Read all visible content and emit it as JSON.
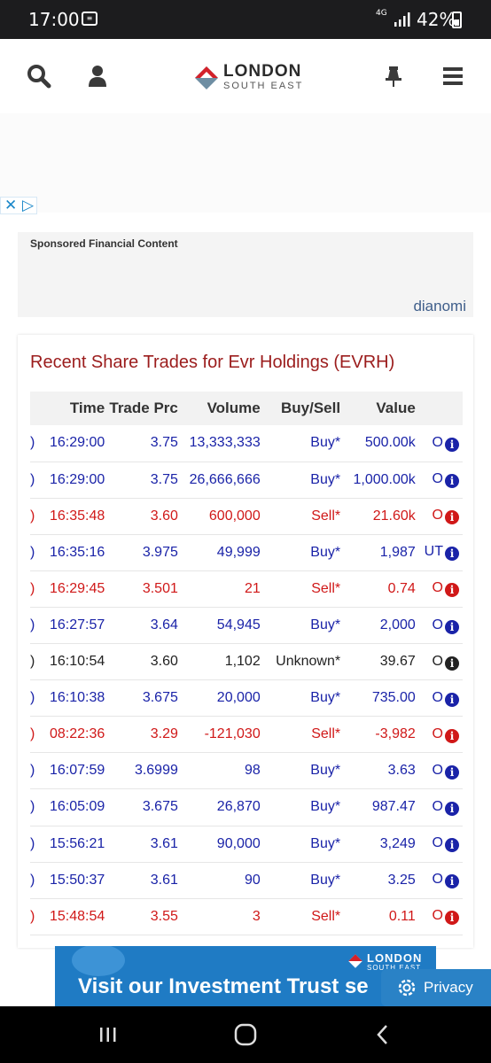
{
  "status_bar": {
    "time": "17:00",
    "network": "4G",
    "battery": "42%"
  },
  "header": {
    "logo_name": "LONDON",
    "logo_sub": "SOUTH EAST",
    "icons": [
      "search-icon",
      "user-icon",
      "pin-icon",
      "menu-icon"
    ]
  },
  "ad_controls": {
    "close": "✕",
    "adchoices": "▷"
  },
  "sponsored": {
    "label": "Sponsored Financial Content",
    "brand": "dianomi"
  },
  "trades": {
    "title": "Recent Share Trades for Evr Holdings (EVRH)",
    "headers": {
      "time": "Time",
      "price": "Trade Prc",
      "volume": "Volume",
      "buysell": "Buy/Sell",
      "value": "Value"
    },
    "colors": {
      "buy": "#1a23a8",
      "sell": "#d01818",
      "unknown": "#222222"
    },
    "rows": [
      {
        "time": "16:29:00",
        "price": "3.75",
        "volume": "13,333,333",
        "buysell": "Buy*",
        "value": "500.00k",
        "type": "O",
        "side": "buy"
      },
      {
        "time": "16:29:00",
        "price": "3.75",
        "volume": "26,666,666",
        "buysell": "Buy*",
        "value": "1,000.00k",
        "type": "O",
        "side": "buy"
      },
      {
        "time": "16:35:48",
        "price": "3.60",
        "volume": "600,000",
        "buysell": "Sell*",
        "value": "21.60k",
        "type": "O",
        "side": "sell"
      },
      {
        "time": "16:35:16",
        "price": "3.975",
        "volume": "49,999",
        "buysell": "Buy*",
        "value": "1,987",
        "type": "UT",
        "side": "buy"
      },
      {
        "time": "16:29:45",
        "price": "3.501",
        "volume": "21",
        "buysell": "Sell*",
        "value": "0.74",
        "type": "O",
        "side": "sell"
      },
      {
        "time": "16:27:57",
        "price": "3.64",
        "volume": "54,945",
        "buysell": "Buy*",
        "value": "2,000",
        "type": "O",
        "side": "buy"
      },
      {
        "time": "16:10:54",
        "price": "3.60",
        "volume": "1,102",
        "buysell": "Unknown*",
        "value": "39.67",
        "type": "O",
        "side": "unknown"
      },
      {
        "time": "16:10:38",
        "price": "3.675",
        "volume": "20,000",
        "buysell": "Buy*",
        "value": "735.00",
        "type": "O",
        "side": "buy"
      },
      {
        "time": "08:22:36",
        "price": "3.29",
        "volume": "-121,030",
        "buysell": "Sell*",
        "value": "-3,982",
        "type": "O",
        "side": "sell"
      },
      {
        "time": "16:07:59",
        "price": "3.6999",
        "volume": "98",
        "buysell": "Buy*",
        "value": "3.63",
        "type": "O",
        "side": "buy"
      },
      {
        "time": "16:05:09",
        "price": "3.675",
        "volume": "26,870",
        "buysell": "Buy*",
        "value": "987.47",
        "type": "O",
        "side": "buy"
      },
      {
        "time": "15:56:21",
        "price": "3.61",
        "volume": "90,000",
        "buysell": "Buy*",
        "value": "3,249",
        "type": "O",
        "side": "buy"
      },
      {
        "time": "15:50:37",
        "price": "3.61",
        "volume": "90",
        "buysell": "Buy*",
        "value": "3.25",
        "type": "O",
        "side": "buy"
      },
      {
        "time": "15:48:54",
        "price": "3.55",
        "volume": "3",
        "buysell": "Sell*",
        "value": "0.11",
        "type": "O",
        "side": "sell"
      }
    ]
  },
  "banner": {
    "text": "Visit our Investment Trust se",
    "logo_name": "LONDON",
    "logo_sub": "SOUTH EAST"
  },
  "privacy": {
    "label": "Privacy"
  }
}
